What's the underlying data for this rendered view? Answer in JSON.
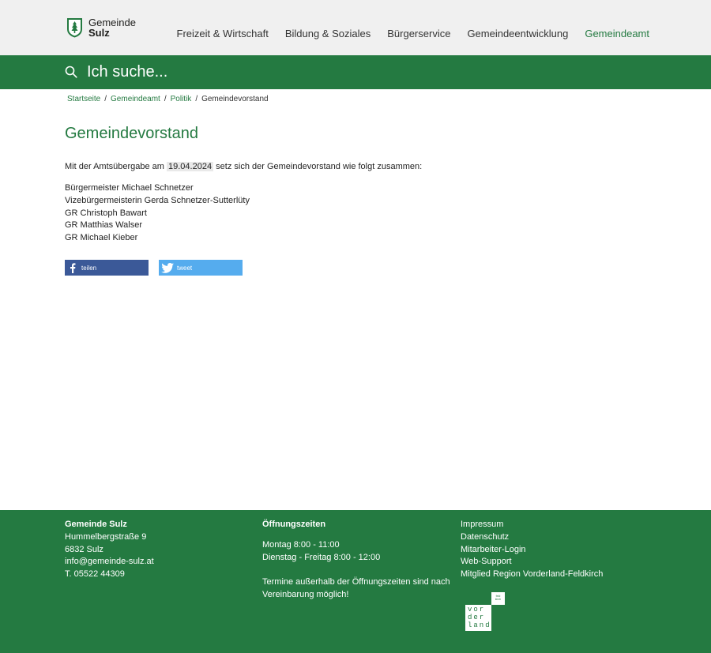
{
  "brand": {
    "line1": "Gemeinde",
    "line2": "Sulz"
  },
  "nav": {
    "items": [
      {
        "label": "Freizeit & Wirtschaft"
      },
      {
        "label": "Bildung & Soziales"
      },
      {
        "label": "Bürgerservice"
      },
      {
        "label": "Gemeindeentwicklung"
      },
      {
        "label": "Gemeindeamt"
      }
    ],
    "active": "Gemeindeamt"
  },
  "search": {
    "placeholder": "Ich suche..."
  },
  "breadcrumb": {
    "items": [
      "Startseite",
      "Gemeindeamt",
      "Politik"
    ],
    "current": "Gemeindevorstand",
    "separator": "/"
  },
  "main": {
    "title": "Gemeindevorstand",
    "intro_before": "Mit der Amtsübergabe am",
    "intro_date": "19.04.2024",
    "intro_after": "setz sich der Gemeindevorstand wie folgt zusammen:",
    "members": [
      "Bürgermeister Michael Schnetzer",
      "Vizebürgermeisterin Gerda Schnetzer-Sutterlüty",
      "GR Christoph Bawart",
      "GR Matthias Walser",
      "GR Michael Kieber"
    ]
  },
  "share": {
    "facebook_label": "teilen",
    "twitter_label": "tweet"
  },
  "footer": {
    "contact": {
      "name": "Gemeinde Sulz",
      "street": "Hummelbergstraße 9",
      "city": "6832 Sulz",
      "email": "info@gemeinde-sulz.at",
      "phone": "T. 05522 44309"
    },
    "hours": {
      "title": "Öffnungszeiten",
      "line1": "Montag 8:00 - 11:00",
      "line2": "Dienstag - Freitag 8:00 - 12:00",
      "note": "Termine außerhalb der Öffnungszeiten sind nach Vereinbarung möglich!"
    },
    "links": [
      "Impressum",
      "Datenschutz",
      "Mitarbeiter-Login",
      "Web-Support",
      "Mitglied Region Vorderland-Feldkirch"
    ],
    "region_logo": {
      "line1": "vor",
      "line2": "der",
      "line3": "land",
      "tag1": "feld",
      "tag2": "kirch"
    }
  },
  "colors": {
    "brand_green": "#247a41",
    "header_bg": "#f0f0f0",
    "facebook": "#3b5998",
    "twitter": "#55acee"
  },
  "icons": [
    "shield-logo",
    "search-icon",
    "facebook-icon",
    "twitter-icon"
  ]
}
